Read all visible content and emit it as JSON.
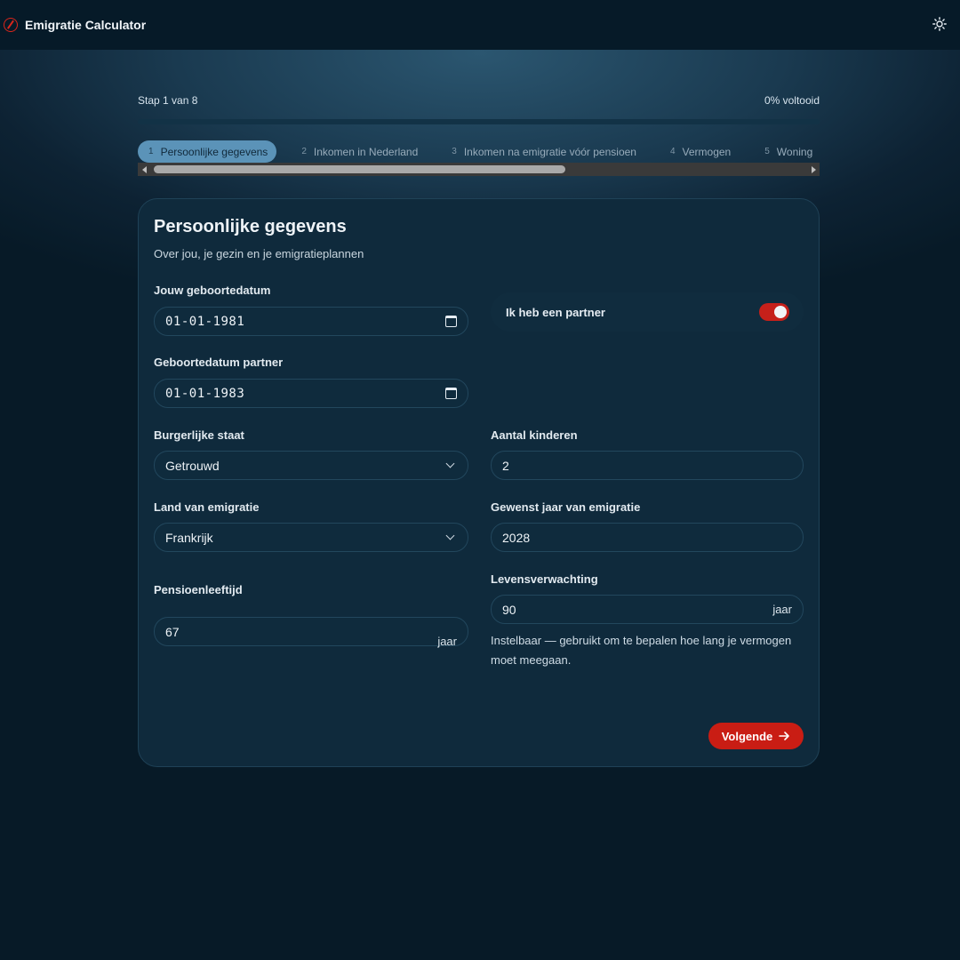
{
  "app": {
    "title": "Emigratie Calculator"
  },
  "progress": {
    "step_label": "Stap 1 van 8",
    "complete_label": "0% voltooid",
    "fraction": 0
  },
  "steps": [
    {
      "num": "1",
      "label": "Persoonlijke gegevens",
      "active": true
    },
    {
      "num": "2",
      "label": "Inkomen in Nederland",
      "active": false
    },
    {
      "num": "3",
      "label": "Inkomen na emigratie vóór pensioen",
      "active": false
    },
    {
      "num": "4",
      "label": "Vermogen",
      "active": false
    },
    {
      "num": "5",
      "label": "Woning",
      "active": false
    }
  ],
  "card": {
    "title": "Persoonlijke gegevens",
    "subtitle": "Over jou, je gezin en je emigratieplannen"
  },
  "form": {
    "birthdate": {
      "label": "Jouw geboortedatum",
      "value": "01-01-1981"
    },
    "partner_toggle": {
      "label": "Ik heb een partner",
      "checked": true
    },
    "partner_birthdate": {
      "label": "Geboortedatum partner",
      "value": "01-01-1983"
    },
    "civil_status": {
      "label": "Burgerlijke staat",
      "value": "Getrouwd"
    },
    "children": {
      "label": "Aantal kinderen",
      "value": "2"
    },
    "country": {
      "label": "Land van emigratie",
      "value": "Frankrijk"
    },
    "emigration_year": {
      "label": "Gewenst jaar van emigratie",
      "value": "2028"
    },
    "pension_age": {
      "label": "Pensioenleeftijd",
      "value": "67",
      "suffix": "jaar"
    },
    "life_expectancy": {
      "label": "Levensverwachting",
      "value": "90",
      "suffix": "jaar",
      "help": "Instelbaar — gebruikt om te bepalen hoe lang je vermogen moet meegaan."
    }
  },
  "buttons": {
    "next": "Volgende"
  },
  "colors": {
    "accent": "#c91d14",
    "background": "#071a27",
    "card": "#0f2a3c",
    "step_active": "#5b93b8"
  },
  "icons": {
    "brand": "compass-icon",
    "theme": "sun-icon",
    "next": "arrow-right-icon"
  }
}
